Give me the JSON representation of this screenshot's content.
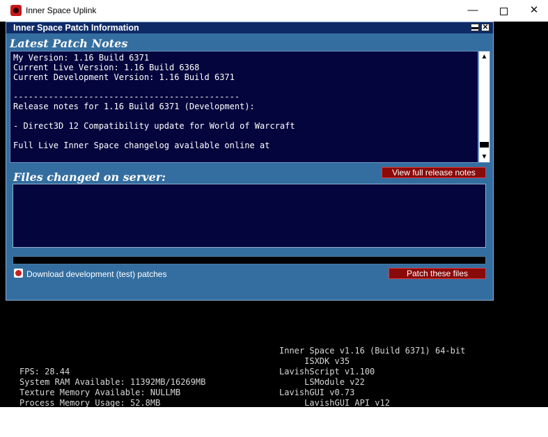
{
  "window": {
    "title": "Inner Space Uplink",
    "min_glyph": "—",
    "close_glyph": "✕"
  },
  "panel": {
    "title": "Inner Space Patch Information",
    "min_glyph": "▬",
    "close_glyph": "✕",
    "notes_label": "Latest Patch Notes",
    "notes_lines": [
      "My Version: 1.16 Build 6371",
      "Current Live Version: 1.16 Build 6368",
      "Current Development Version: 1.16 Build 6371",
      "",
      "---------------------------------------------",
      "Release notes for 1.16 Build 6371 (Development):",
      "",
      "- Direct3D 12 Compatibility update for World of Warcraft",
      "",
      "Full Live Inner Space changelog available online at"
    ],
    "scroll_up_glyph": "▲",
    "scroll_down_glyph": "▼",
    "view_button": "View full release notes",
    "files_label": "Files changed on server:",
    "checkbox_label": "Download development (test) patches",
    "patch_button": "Patch these files",
    "progress": 0
  },
  "console": {
    "right": [
      "Inner Space v1.16 (Build 6371) 64-bit",
      "     ISXDK v35",
      "LavishScript v1.100",
      "     LSModule v22",
      "LavishGUI v0.73",
      "     LavishGUI API v12"
    ],
    "left": [
      "FPS: 28.44",
      "System RAM Available: 11392MB/16269MB",
      "Texture Memory Available: NULLMB",
      "Process Memory Usage: 52.8MB"
    ]
  },
  "colors": {
    "panel_bg": "#346ea0",
    "header_bg": "#0e2a66",
    "text_box_bg": "#05053d",
    "button_red": "#8a0a0a"
  },
  "icons": {
    "app": "inner-space-logo-icon",
    "checkbox": "red-radio-icon"
  }
}
